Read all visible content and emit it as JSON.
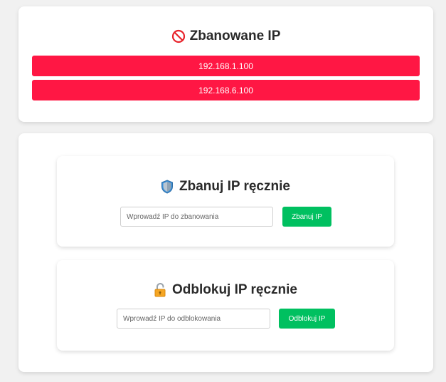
{
  "banned": {
    "title": "Zbanowane IP",
    "ips": [
      "192.168.1.100",
      "192.168.6.100"
    ]
  },
  "ban_section": {
    "title": "Zbanuj IP ręcznie",
    "input_placeholder": "Wprowadź IP do zbanowania",
    "button_label": "Zbanuj IP"
  },
  "unban_section": {
    "title": "Odblokuj IP ręcznie",
    "input_placeholder": "Wprowadź IP do odblokowania",
    "button_label": "Odblokuj IP"
  },
  "icons": {
    "banned_title": "prohibited-icon",
    "ban_section": "shield-icon",
    "unban_section": "unlocked-lock-icon"
  },
  "colors": {
    "ip_row_bg": "#ff1744",
    "action_button": "#00c060",
    "prohibited_icon": "#e8232b"
  }
}
